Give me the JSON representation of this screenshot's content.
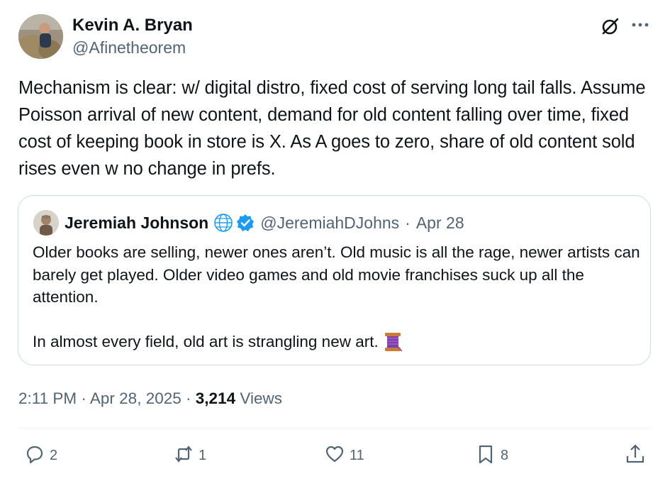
{
  "author": {
    "name": "Kevin A. Bryan",
    "handle": "@Afinetheorem",
    "avatar_icon": "profile-photo"
  },
  "header_icons": [
    "grok-icon",
    "more-icon"
  ],
  "tweet": {
    "text": "Mechanism is clear: w/ digital distro, fixed cost of serving long tail falls. Assume Poisson arrival of new content, demand for old content falling over time, fixed cost of keeping book in store is X. As A goes to zero, share of old content sold rises even w no change in prefs."
  },
  "quote": {
    "name": "Jeremiah Johnson",
    "handle": "@JeremiahDJohns",
    "separator": "·",
    "date": "Apr 28",
    "paragraph1": "Older books are selling, newer ones aren’t. Old music is all the rage, newer artists can barely get played. Older video games and old movie franchises suck up all the attention.",
    "paragraph2": "In almost every field, old art is strangling new art.",
    "badges": [
      "globe-icon",
      "verified-badge-icon"
    ],
    "emoji": "spool-of-thread-icon",
    "verified_color": "#1d9bf0"
  },
  "meta": {
    "time": "2:11 PM",
    "sep1": "·",
    "date": "Apr 28, 2025",
    "sep2": "·",
    "views_count": "3,214",
    "views_label": "Views"
  },
  "actions": {
    "replies": "2",
    "reposts": "1",
    "likes": "11",
    "bookmarks": "8"
  },
  "colors": {
    "text": "#0f1419",
    "secondary": "#536471",
    "border": "#cfd9de"
  }
}
